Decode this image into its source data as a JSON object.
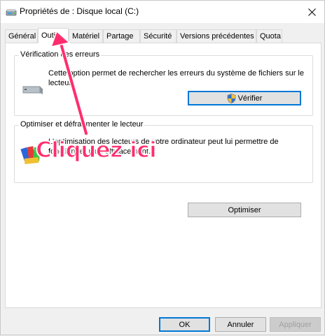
{
  "window": {
    "title": "Propriétés de : Disque local (C:)"
  },
  "tabs": [
    {
      "label": "Général"
    },
    {
      "label": "Outils"
    },
    {
      "label": "Matériel"
    },
    {
      "label": "Partage"
    },
    {
      "label": "Sécurité"
    },
    {
      "label": "Versions précédentes"
    },
    {
      "label": "Quota"
    }
  ],
  "active_tab": "Outils",
  "error_check": {
    "heading": "Vérification des erreurs",
    "description_line1": "Cette option permet de rechercher les erreurs du système de fichiers sur le",
    "description_line2": "lecteur.",
    "button_label": "Vérifier"
  },
  "optimize": {
    "heading": "Optimiser et défragmenter le lecteur",
    "description_line1": "L'optimisation des lecteurs de votre ordinateur peut lui permettre de",
    "description_line2": "fonctionner plus efficacement.",
    "button_label": "Optimiser"
  },
  "annotation": {
    "text": "Cliquez ici",
    "color": "#ff2d6e"
  },
  "footer": {
    "ok_label": "OK",
    "cancel_label": "Annuler",
    "apply_label": "Appliquer"
  },
  "colors": {
    "accent": "#0078d7",
    "annotation": "#ff2d6e"
  },
  "icons": {
    "title": "drive-icon",
    "close": "close-icon",
    "error_check": "hard-drive-icon",
    "verify_button": "uac-shield-icon",
    "optimize": "defrag-icon"
  }
}
